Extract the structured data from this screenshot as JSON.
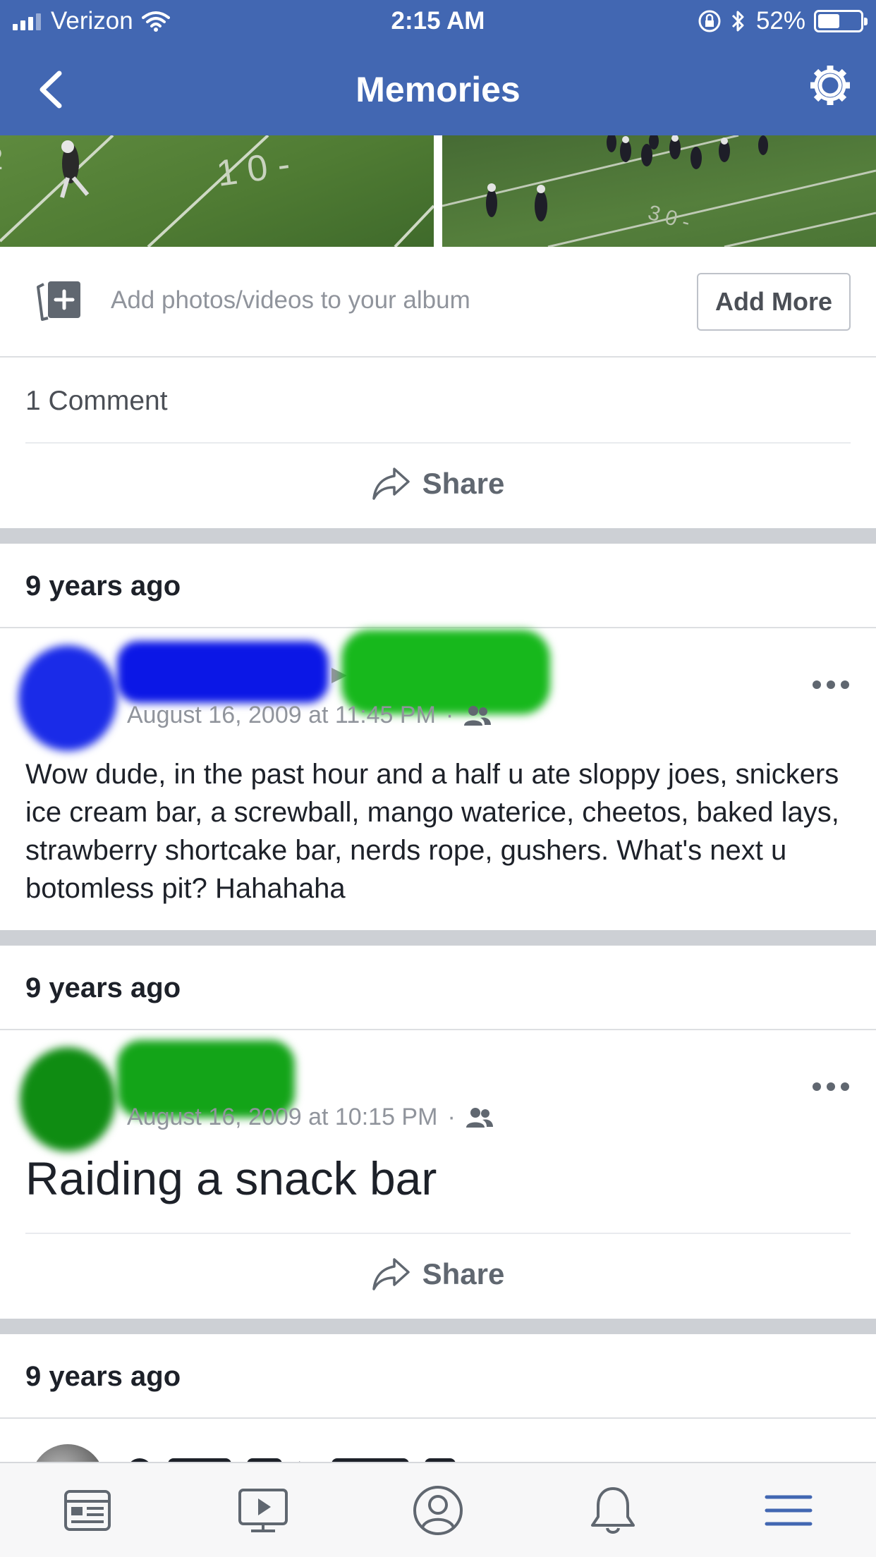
{
  "status_bar": {
    "carrier": "Verizon",
    "time": "2:15 AM",
    "battery": "52%",
    "battery_level": 0.52
  },
  "header": {
    "title": "Memories",
    "back_icon": "chevron-left-icon",
    "settings_icon": "gear-icon",
    "background_color": "#4267b2"
  },
  "album": {
    "add_text": "Add photos/videos to your album",
    "add_more_label": "Add More"
  },
  "comments": {
    "count_label": "1 Comment"
  },
  "share_label": "Share",
  "memories": [
    {
      "time_ago": "9 years ago",
      "date": "August 16, 2009 at 11:45 PM",
      "text": "Wow dude, in the past hour and a half u ate sloppy joes, snickers ice cream bar, a screwball, mango waterice, cheetos, baked lays, strawberry shortcake bar, nerds rope, gushers. What's next u botomless pit? Hahahaha"
    },
    {
      "time_ago": "9 years ago",
      "date": "August 16, 2009 at 10:15 PM",
      "text": "Raiding a snack bar"
    },
    {
      "time_ago": "9 years ago"
    }
  ],
  "tab_bar": {
    "tabs": [
      "news-feed-icon",
      "watch-icon",
      "profile-icon",
      "notifications-icon",
      "menu-icon"
    ],
    "active_color": "#4267b2"
  }
}
